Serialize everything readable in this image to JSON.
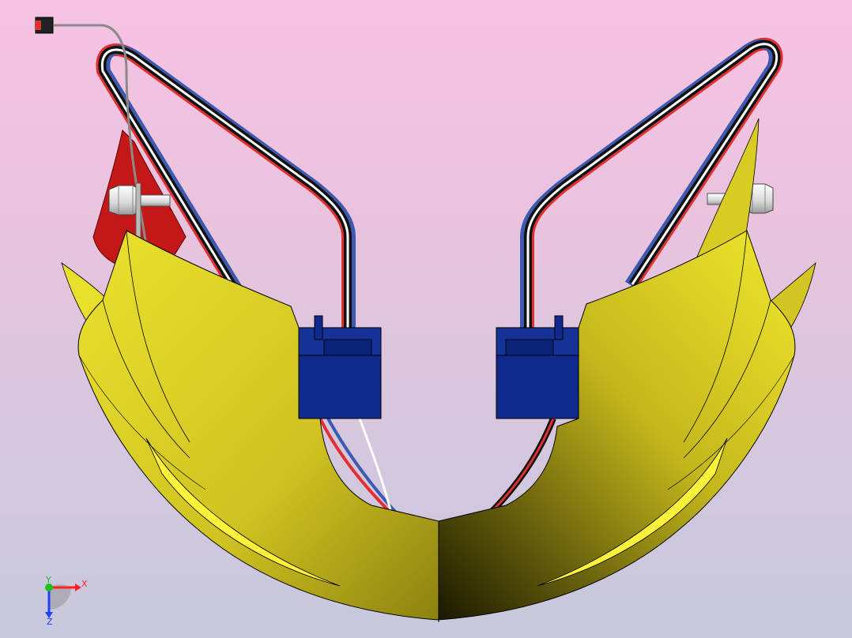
{
  "viewport": {
    "background_top": "#f7c3e3",
    "background_bottom": "#c7c9dc"
  },
  "colors": {
    "shell": "#e2d52a",
    "shell_dark": "#8e8410",
    "shell_highlight": "#ffff40",
    "servo": "#0f2a8c",
    "servo_dark": "#091b60",
    "wire_black": "#111111",
    "wire_red": "#e03030",
    "wire_white": "#ffffff",
    "wire_blue": "#3d5ab0",
    "red_part": "#c41818",
    "standoff": "#f0f0f0"
  },
  "triad": {
    "x_label": "X",
    "y_label": "Y",
    "z_label": "Z",
    "x_color": "#ff2020",
    "y_color": "#20c020",
    "z_color": "#2040ff"
  }
}
